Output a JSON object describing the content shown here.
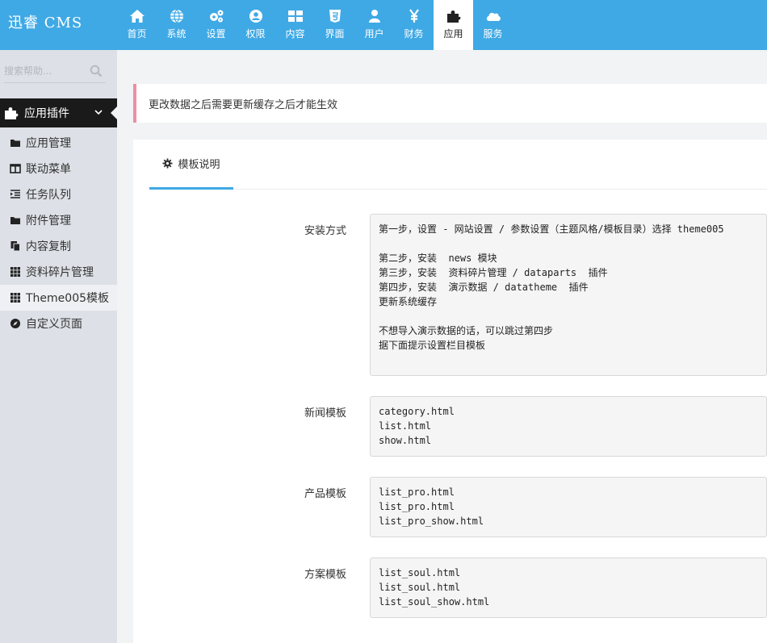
{
  "brand": "迅睿 CMS",
  "topnav": [
    {
      "label": "首页",
      "icon": "home-icon"
    },
    {
      "label": "系统",
      "icon": "globe-icon"
    },
    {
      "label": "设置",
      "icon": "cogs-icon"
    },
    {
      "label": "权限",
      "icon": "user-circle-icon"
    },
    {
      "label": "内容",
      "icon": "table-icon"
    },
    {
      "label": "界面",
      "icon": "html5-icon"
    },
    {
      "label": "用户",
      "icon": "user-icon"
    },
    {
      "label": "财务",
      "icon": "yen-icon"
    },
    {
      "label": "应用",
      "icon": "puzzle-icon",
      "active": true
    },
    {
      "label": "服务",
      "icon": "cloud-icon"
    }
  ],
  "sidebar": {
    "search_placeholder": "搜索帮助...",
    "section_title": "应用插件",
    "items": [
      {
        "label": "应用管理",
        "icon": "folder-icon"
      },
      {
        "label": "联动菜单",
        "icon": "columns-icon"
      },
      {
        "label": "任务队列",
        "icon": "indent-icon"
      },
      {
        "label": "附件管理",
        "icon": "folder-icon"
      },
      {
        "label": "内容复制",
        "icon": "copy-icon"
      },
      {
        "label": "资料碎片管理",
        "icon": "grid-icon"
      },
      {
        "label": "Theme005模板",
        "icon": "grid-icon",
        "active": true
      },
      {
        "label": "自定义页面",
        "icon": "compass-icon"
      }
    ]
  },
  "alert": "更改数据之后需要更新缓存之后才能生效",
  "tab": {
    "label": "模板说明",
    "icon": "gear-icon"
  },
  "rows": [
    {
      "label": "安装方式",
      "content": "第一步，设置 - 网站设置 / 参数设置（主题风格/模板目录）选择 theme005\n\n第二步，安装  news 模块\n第三步，安装  资料碎片管理 / dataparts  插件\n第四步，安装  演示数据 / datatheme  插件\n更新系统缓存\n\n不想导入演示数据的话，可以跳过第四步\n据下面提示设置栏目模板\n"
    },
    {
      "label": "新闻模板",
      "content": "category.html\nlist.html\nshow.html"
    },
    {
      "label": "产品模板",
      "content": "list_pro.html\nlist_pro.html\nlist_pro_show.html"
    },
    {
      "label": "方案模板",
      "content": "list_soul.html\nlist_soul.html\nlist_soul_show.html"
    }
  ],
  "colors": {
    "header": "#3fa9e5",
    "sidebar": "#dde0e6",
    "alert_border": "#ee8ea3"
  }
}
